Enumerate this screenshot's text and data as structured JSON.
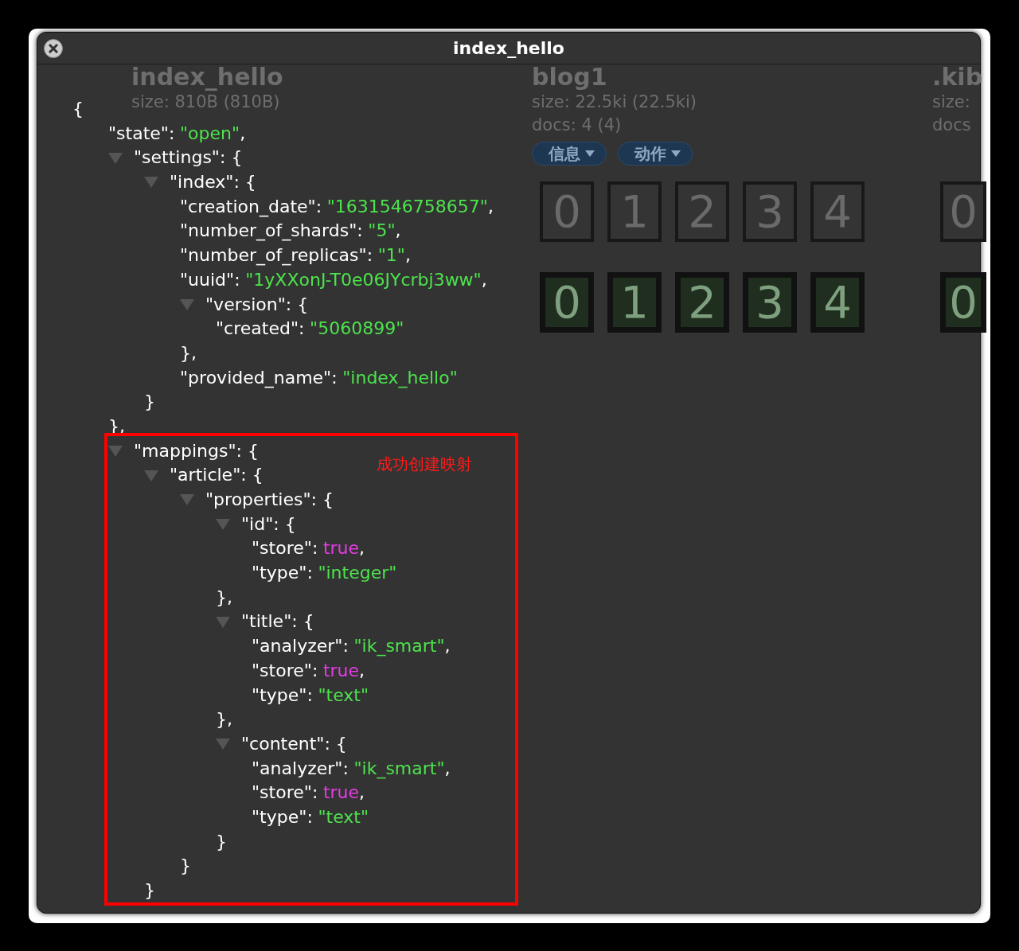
{
  "page": {
    "columns": [
      {
        "name": "index_hello",
        "size": "size: 810B (810B)"
      },
      {
        "name": "blog1",
        "size": "size: 22.5ki (22.5ki)",
        "docs": "docs: 4 (4)",
        "buttons": [
          {
            "label": "信息"
          },
          {
            "label": "动作"
          }
        ],
        "replica_shards": [
          "0",
          "1",
          "2",
          "3",
          "4"
        ],
        "primary_shards": [
          "0",
          "1",
          "2",
          "3",
          "4"
        ]
      },
      {
        "name": ".kib",
        "size": "size:",
        "docs": "docs",
        "replica_shards": [
          "0"
        ],
        "primary_shards": [
          "0"
        ]
      }
    ]
  },
  "dialog": {
    "title": "index_hello",
    "tree": {
      "open": "{",
      "children": [
        {
          "kind": "string",
          "key": "\"state\":",
          "value": "\"open\"",
          "end": ","
        },
        {
          "kind": "object",
          "key": "\"settings\": {",
          "expanded": true,
          "close": "},",
          "children": [
            {
              "kind": "object",
              "key": "\"index\": {",
              "expanded": true,
              "close": "}",
              "children": [
                {
                  "kind": "string",
                  "key": "\"creation_date\":",
                  "value": "\"1631546758657\"",
                  "end": ","
                },
                {
                  "kind": "string",
                  "key": "\"number_of_shards\":",
                  "value": "\"5\"",
                  "end": ","
                },
                {
                  "kind": "string",
                  "key": "\"number_of_replicas\":",
                  "value": "\"1\"",
                  "end": ","
                },
                {
                  "kind": "string",
                  "key": "\"uuid\":",
                  "value": "\"1yXXonJ-T0e06JYcrbj3ww\"",
                  "end": ","
                },
                {
                  "kind": "object",
                  "key": "\"version\": {",
                  "expanded": true,
                  "close": "},",
                  "children": [
                    {
                      "kind": "string",
                      "key": "\"created\":",
                      "value": "\"5060899\""
                    }
                  ]
                },
                {
                  "kind": "string",
                  "key": "\"provided_name\":",
                  "value": "\"index_hello\""
                }
              ]
            }
          ]
        },
        {
          "kind": "object",
          "key": "\"mappings\": {",
          "expanded": true,
          "children": [
            {
              "kind": "object",
              "key": "\"article\": {",
              "expanded": true,
              "close": "}",
              "children": [
                {
                  "kind": "object",
                  "key": "\"properties\": {",
                  "expanded": true,
                  "close": "}",
                  "children": [
                    {
                      "kind": "object",
                      "key": "\"id\": {",
                      "expanded": true,
                      "close": "},",
                      "children": [
                        {
                          "kind": "boolean",
                          "key": "\"store\":",
                          "value": "true",
                          "end": ","
                        },
                        {
                          "kind": "string",
                          "key": "\"type\":",
                          "value": "\"integer\""
                        }
                      ]
                    },
                    {
                      "kind": "object",
                      "key": "\"title\": {",
                      "expanded": true,
                      "close": "},",
                      "children": [
                        {
                          "kind": "string",
                          "key": "\"analyzer\":",
                          "value": "\"ik_smart\"",
                          "end": ","
                        },
                        {
                          "kind": "boolean",
                          "key": "\"store\":",
                          "value": "true",
                          "end": ","
                        },
                        {
                          "kind": "string",
                          "key": "\"type\":",
                          "value": "\"text\""
                        }
                      ]
                    },
                    {
                      "kind": "object",
                      "key": "\"content\": {",
                      "expanded": true,
                      "close": "}",
                      "children": [
                        {
                          "kind": "string",
                          "key": "\"analyzer\":",
                          "value": "\"ik_smart\"",
                          "end": ","
                        },
                        {
                          "kind": "boolean",
                          "key": "\"store\":",
                          "value": "true",
                          "end": ","
                        },
                        {
                          "kind": "string",
                          "key": "\"type\":",
                          "value": "\"text\""
                        }
                      ]
                    }
                  ]
                }
              ]
            }
          ]
        }
      ]
    }
  },
  "annotation": {
    "text": "成功创建映射"
  }
}
